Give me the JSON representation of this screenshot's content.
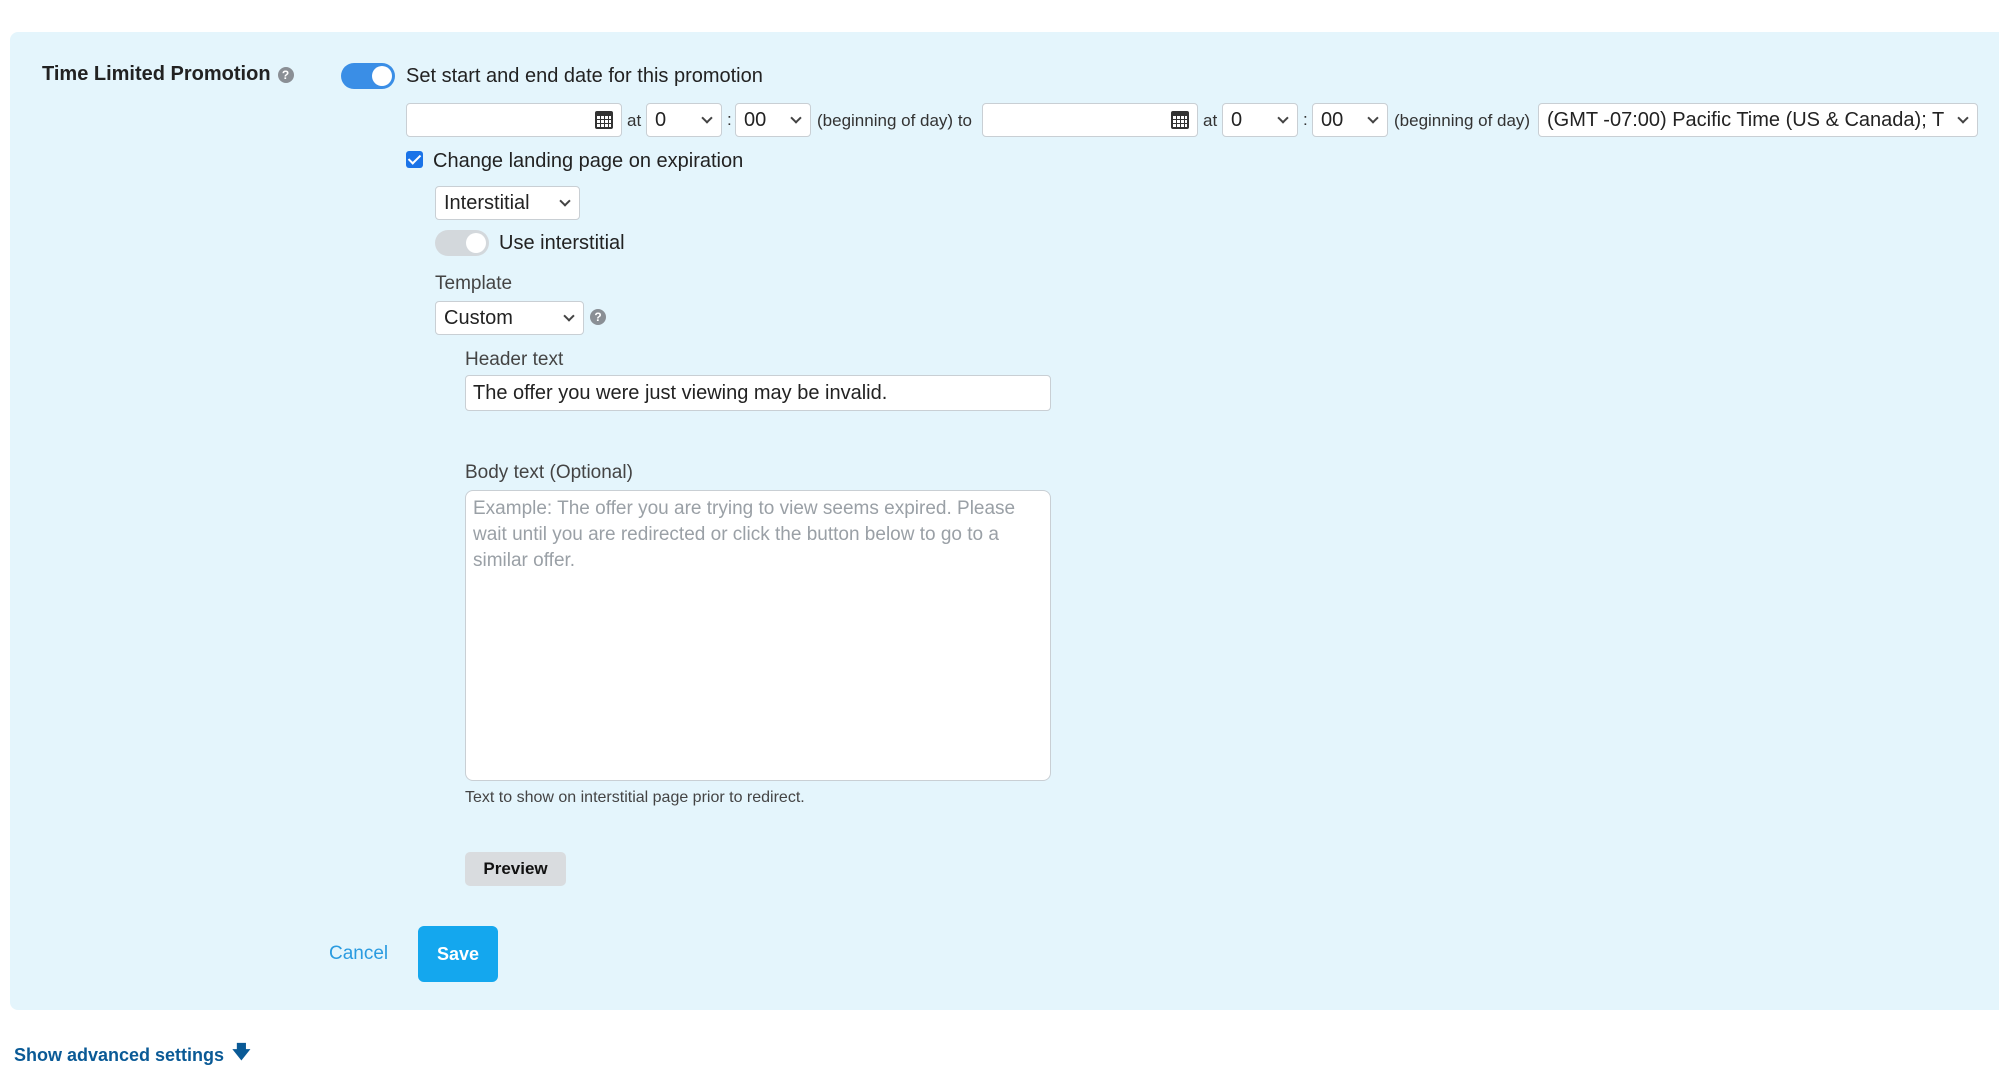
{
  "section": {
    "label": "Time Limited Promotion",
    "help_icon": "question-circle-icon"
  },
  "schedule": {
    "toggle_label": "Set start and end date for this promotion",
    "toggle_on": true,
    "start_date": "",
    "at1": "at",
    "start_hour": "0",
    "colon1": ":",
    "start_minute": "00",
    "start_suffix": "(beginning of day) to",
    "end_date": "",
    "at2": "at",
    "end_hour": "0",
    "colon2": ":",
    "end_minute": "00",
    "end_suffix": "(beginning of day)",
    "timezone": "(GMT -07:00) Pacific Time (US & Canada); T"
  },
  "expiration": {
    "checkbox_label": "Change landing page on expiration",
    "checked": true,
    "landing_type": "Interstitial",
    "use_interstitial_label": "Use interstitial",
    "template_label": "Template",
    "template_value": "Custom",
    "header_label": "Header text",
    "header_value": "The offer you were just viewing may be invalid.",
    "body_label": "Body text (Optional)",
    "body_placeholder": "Example: The offer you are trying to view seems expired. Please wait until you are redirected or click the button below to go to a similar offer.",
    "body_hint": "Text to show on interstitial page prior to redirect.",
    "preview_label": "Preview"
  },
  "actions": {
    "cancel_label": "Cancel",
    "save_label": "Save"
  },
  "footer": {
    "advanced_label": "Show advanced settings"
  },
  "colors": {
    "panel_bg": "#e4f5fc",
    "accent": "#3a8ee6",
    "save_button": "#14a7ee",
    "link": "#2a9be0"
  }
}
